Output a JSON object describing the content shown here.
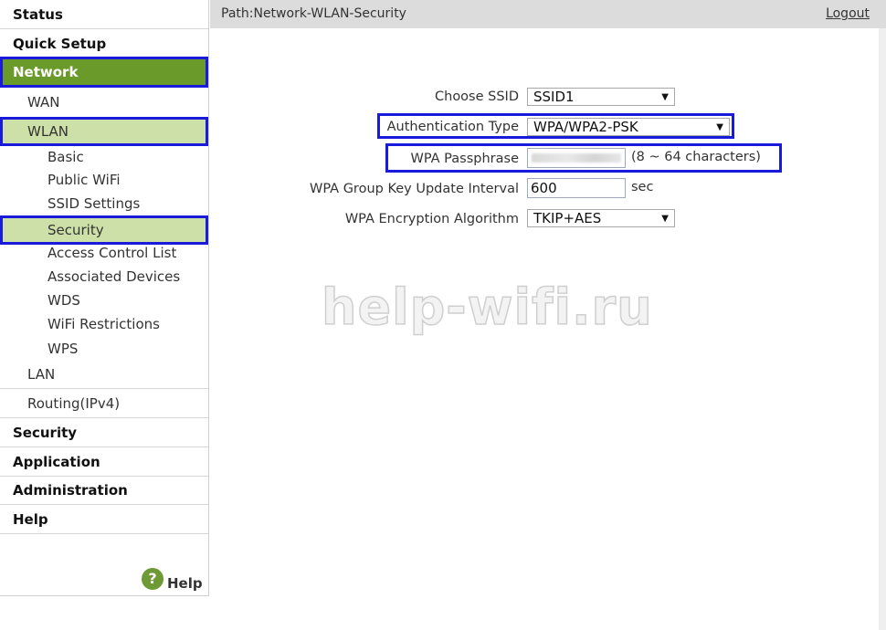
{
  "sidebar": {
    "status": "Status",
    "quick_setup": "Quick Setup",
    "network": "Network",
    "wan": "WAN",
    "wlan": "WLAN",
    "wlan_items": {
      "basic": "Basic",
      "public_wifi": "Public WiFi",
      "ssid_settings": "SSID Settings",
      "security": "Security",
      "acl": "Access Control List",
      "associated": "Associated Devices",
      "wds": "WDS",
      "wifi_restrictions": "WiFi Restrictions",
      "wps": "WPS"
    },
    "lan": "LAN",
    "routing": "Routing(IPv4)",
    "security": "Security",
    "application": "Application",
    "administration": "Administration",
    "help": "Help",
    "help_bottom": "Help",
    "help_icon_glyph": "?"
  },
  "header": {
    "path": "Path:Network-WLAN-Security",
    "logout": "Logout"
  },
  "form": {
    "choose_ssid_label": "Choose SSID",
    "choose_ssid_value": "SSID1",
    "auth_type_label": "Authentication Type",
    "auth_type_value": "WPA/WPA2-PSK",
    "passphrase_label": "WPA Passphrase",
    "passphrase_hint": "(8 ~ 64 characters)",
    "group_key_label": "WPA Group Key Update Interval",
    "group_key_value": "600",
    "group_key_unit": "sec",
    "encryption_label": "WPA Encryption Algorithm",
    "encryption_value": "TKIP+AES"
  },
  "watermark": "help-wifi.ru",
  "colors": {
    "network_active_bg": "#6a9a2a",
    "wlan_active_bg": "#cde0a8",
    "highlight_border": "#1a1adc",
    "header_bg": "#dcdcdc"
  }
}
